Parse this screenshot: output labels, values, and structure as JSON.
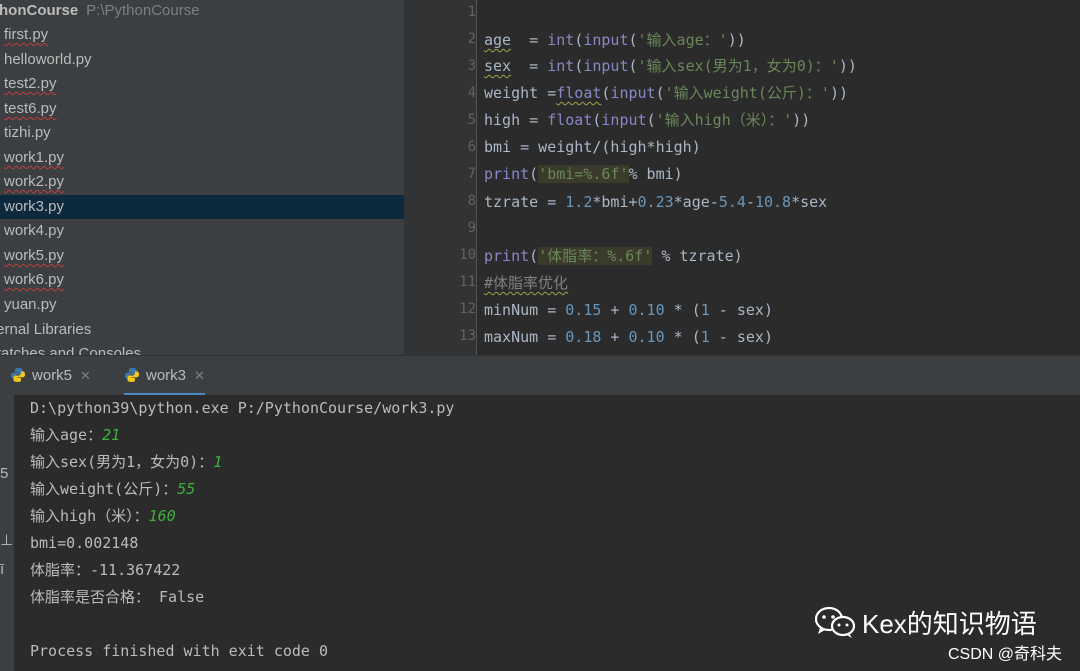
{
  "project": {
    "root_name": "thonCourse",
    "root_path": "P:\\PythonCourse",
    "files": [
      {
        "name": "first.py",
        "error": true
      },
      {
        "name": "helloworld.py",
        "error": false
      },
      {
        "name": "test2.py",
        "error": true
      },
      {
        "name": "test6.py",
        "error": true
      },
      {
        "name": "tizhi.py",
        "error": false
      },
      {
        "name": "work1.py",
        "error": true
      },
      {
        "name": "work2.py",
        "error": true
      },
      {
        "name": "work3.py",
        "error": false,
        "selected": true
      },
      {
        "name": "work4.py",
        "error": false
      },
      {
        "name": "work5.py",
        "error": true
      },
      {
        "name": "work6.py",
        "error": true
      },
      {
        "name": "yuan.py",
        "error": false
      },
      {
        "name": "ternal Libraries",
        "error": false
      },
      {
        "name": "ratches and Consoles",
        "error": false
      }
    ]
  },
  "editor": {
    "line_numbers": [
      "1",
      "2",
      "3",
      "4",
      "5",
      "6",
      "7",
      "8",
      "9",
      "10",
      "11",
      "12",
      "13"
    ]
  },
  "run_tabs": [
    {
      "label": "work5",
      "active": false
    },
    {
      "label": "work3",
      "active": true
    }
  ],
  "console": {
    "command": "D:\\python39\\python.exe P:/PythonCourse/work3.py",
    "lines": [
      {
        "prompt": "输入age：",
        "input": "21"
      },
      {
        "prompt": "输入sex(男为1，女为0)：",
        "input": "1"
      },
      {
        "prompt": "输入weight(公斤)：",
        "input": "55"
      },
      {
        "prompt": "输入high（米）：",
        "input": "160"
      }
    ],
    "bmi": "bmi=0.002148",
    "tizhi": "体脂率：-11.367422",
    "pass": "体脂率是否合格： False",
    "finished": "Process finished with exit code 0"
  },
  "watermark": {
    "text": "Kex的知识物语",
    "credit": "CSDN @奇科夫"
  },
  "icons": {
    "python": "python-icon",
    "close": "close-icon",
    "wechat": "wechat-icon"
  },
  "colors": {
    "keyword": "#8888c6",
    "string": "#6a8759",
    "number": "#6897bb",
    "comment": "#808080",
    "selection": "#0d293e",
    "user_input": "#3bb23b"
  }
}
